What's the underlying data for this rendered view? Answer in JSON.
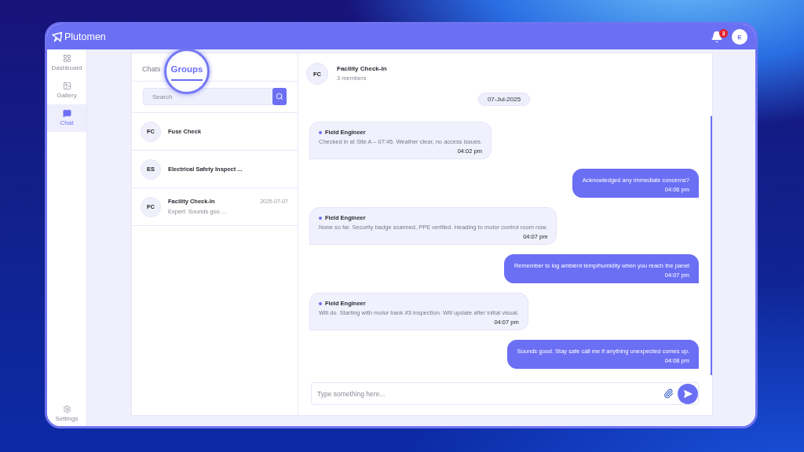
{
  "top_bar": {
    "brand": "Plutomen",
    "notifications": {
      "count": "3"
    },
    "user": {
      "initial": "E"
    }
  },
  "sidebar": {
    "items": [
      {
        "label": "Dashboard",
        "selected": false
      },
      {
        "label": "Gallery",
        "selected": false
      },
      {
        "label": "Chat",
        "selected": true
      }
    ],
    "footer": {
      "label": "Settings"
    }
  },
  "chat_list": {
    "tabs": [
      {
        "label": "Chats",
        "selected": false,
        "highlighted": false
      },
      {
        "label": "Groups",
        "selected": true,
        "highlighted": true
      }
    ],
    "search": {
      "placeholder": "Search"
    },
    "items": [
      {
        "initials": "FC",
        "name": "Fuse Check"
      },
      {
        "initials": "ES",
        "name": "Electrical Safety Inspect ..."
      },
      {
        "initials": "FC",
        "name": "Facility Check-In",
        "date": "2025-07-07",
        "preview": "Expert: Sounds goo ..."
      }
    ]
  },
  "conversation": {
    "header": {
      "initials": "FC",
      "title": "Facility Check-In",
      "subtitle": "3 members"
    },
    "date_separator": "07-Jul-2025",
    "messages": [
      {
        "kind": "incoming",
        "sender": "Field Engineer",
        "text": "Checked in at Site A – 07:45. Weather clear, no access issues.",
        "time": "04:02 pm"
      },
      {
        "kind": "outgoing",
        "text": "Acknowledged any immediate concerns?",
        "time": "04:06 pm"
      },
      {
        "kind": "incoming",
        "sender": "Field Engineer",
        "text": "None so far. Security badge scanned, PPE verified. Heading to motor control room now.",
        "time": "04:07 pm"
      },
      {
        "kind": "outgoing",
        "text": "Remember to log ambient temp/humidity when you reach the panel",
        "time": "04:07 pm"
      },
      {
        "kind": "incoming",
        "sender": "Field Engineer",
        "text": "Will do. Starting with motor bank #3 inspection. Will update after initial visual.",
        "time": "04:07 pm"
      },
      {
        "kind": "outgoing",
        "text": "Sounds good. Stay safe call me if anything unexpected comes up.",
        "time": "04:08 pm"
      }
    ],
    "composer": {
      "placeholder": "Type something here..."
    }
  }
}
